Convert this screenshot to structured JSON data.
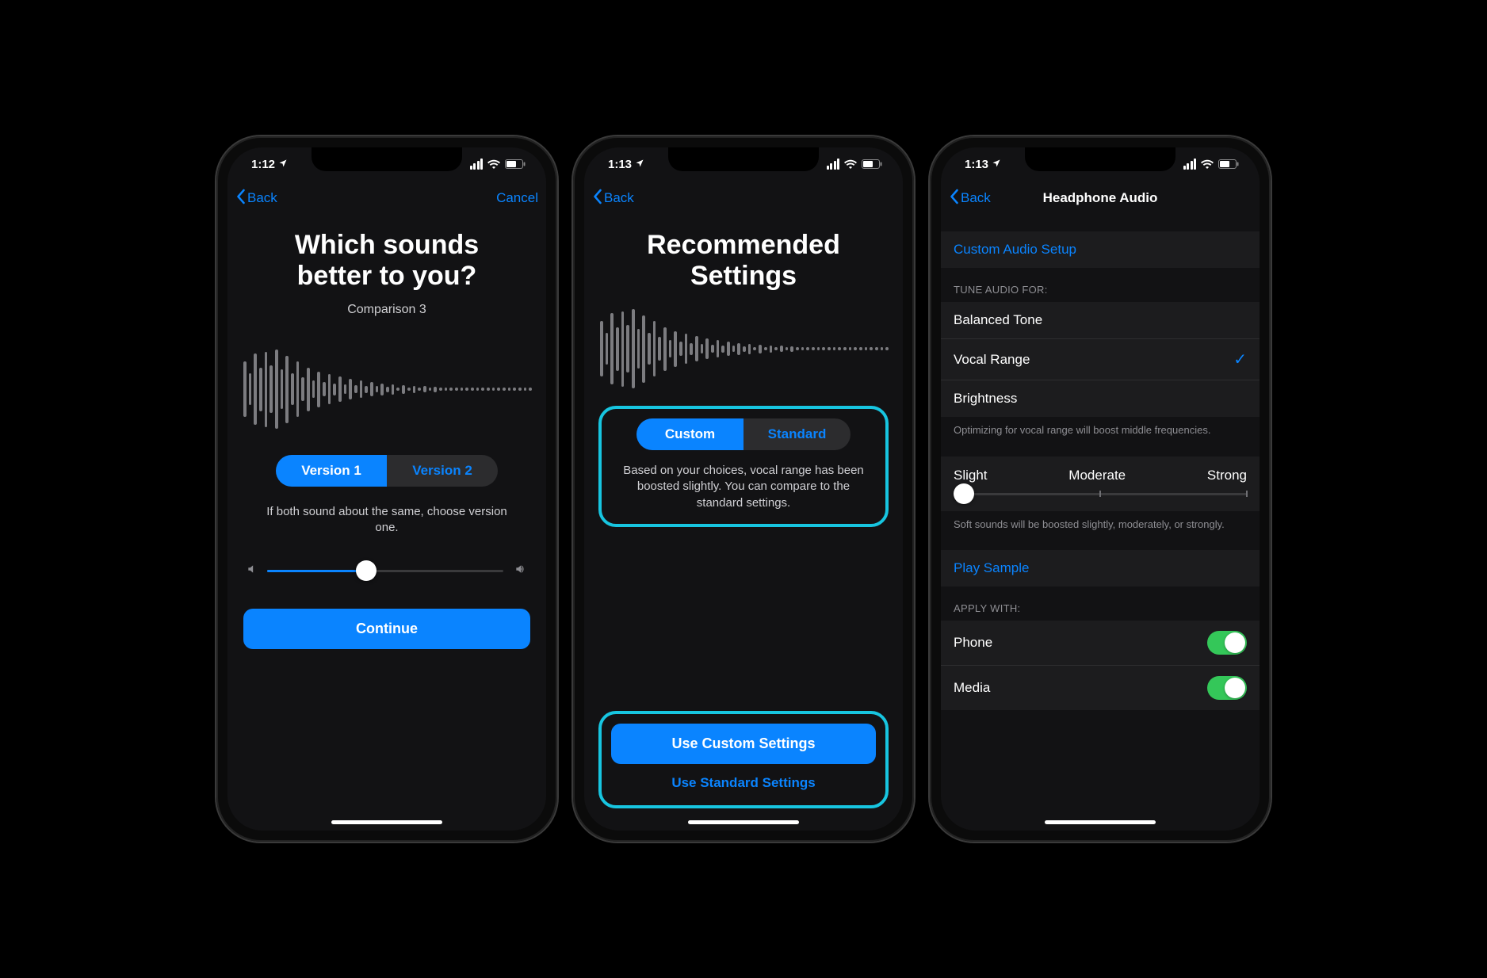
{
  "colors": {
    "accent": "#0a84ff",
    "highlight": "#17c5e0",
    "toggle_on": "#34c759"
  },
  "screen1": {
    "status": {
      "time": "1:12",
      "location_arrow": true
    },
    "nav": {
      "back": "Back",
      "cancel": "Cancel"
    },
    "title_line1": "Which sounds",
    "title_line2": "better to you?",
    "subtitle": "Comparison 3",
    "segments": {
      "v1": "Version 1",
      "v2": "Version 2",
      "active": "v1"
    },
    "hint": "If both sound about the same, choose version one.",
    "volume": {
      "value": 0.42
    },
    "continue": "Continue"
  },
  "screen2": {
    "status": {
      "time": "1:13",
      "location_arrow": true
    },
    "nav": {
      "back": "Back"
    },
    "title_line1": "Recommended",
    "title_line2": "Settings",
    "segments": {
      "custom": "Custom",
      "standard": "Standard",
      "active": "custom"
    },
    "desc": "Based on your choices, vocal range has been boosted slightly. You can compare to the standard settings.",
    "primary": "Use Custom Settings",
    "secondary": "Use Standard Settings"
  },
  "screen3": {
    "status": {
      "time": "1:13",
      "location_arrow": true
    },
    "nav": {
      "back": "Back",
      "title": "Headphone Audio"
    },
    "custom_setup": "Custom Audio Setup",
    "tune_header": "TUNE AUDIO FOR:",
    "tune_options": {
      "balanced": "Balanced Tone",
      "vocal": "Vocal Range",
      "brightness": "Brightness",
      "selected": "vocal"
    },
    "tune_footer": "Optimizing for vocal range will boost middle frequencies.",
    "strength": {
      "left": "Slight",
      "mid": "Moderate",
      "right": "Strong",
      "value": 0
    },
    "strength_footer": "Soft sounds will be boosted slightly, moderately, or strongly.",
    "play_sample": "Play Sample",
    "apply_header": "APPLY WITH:",
    "apply": {
      "phone_label": "Phone",
      "phone_on": true,
      "media_label": "Media",
      "media_on": true
    }
  }
}
